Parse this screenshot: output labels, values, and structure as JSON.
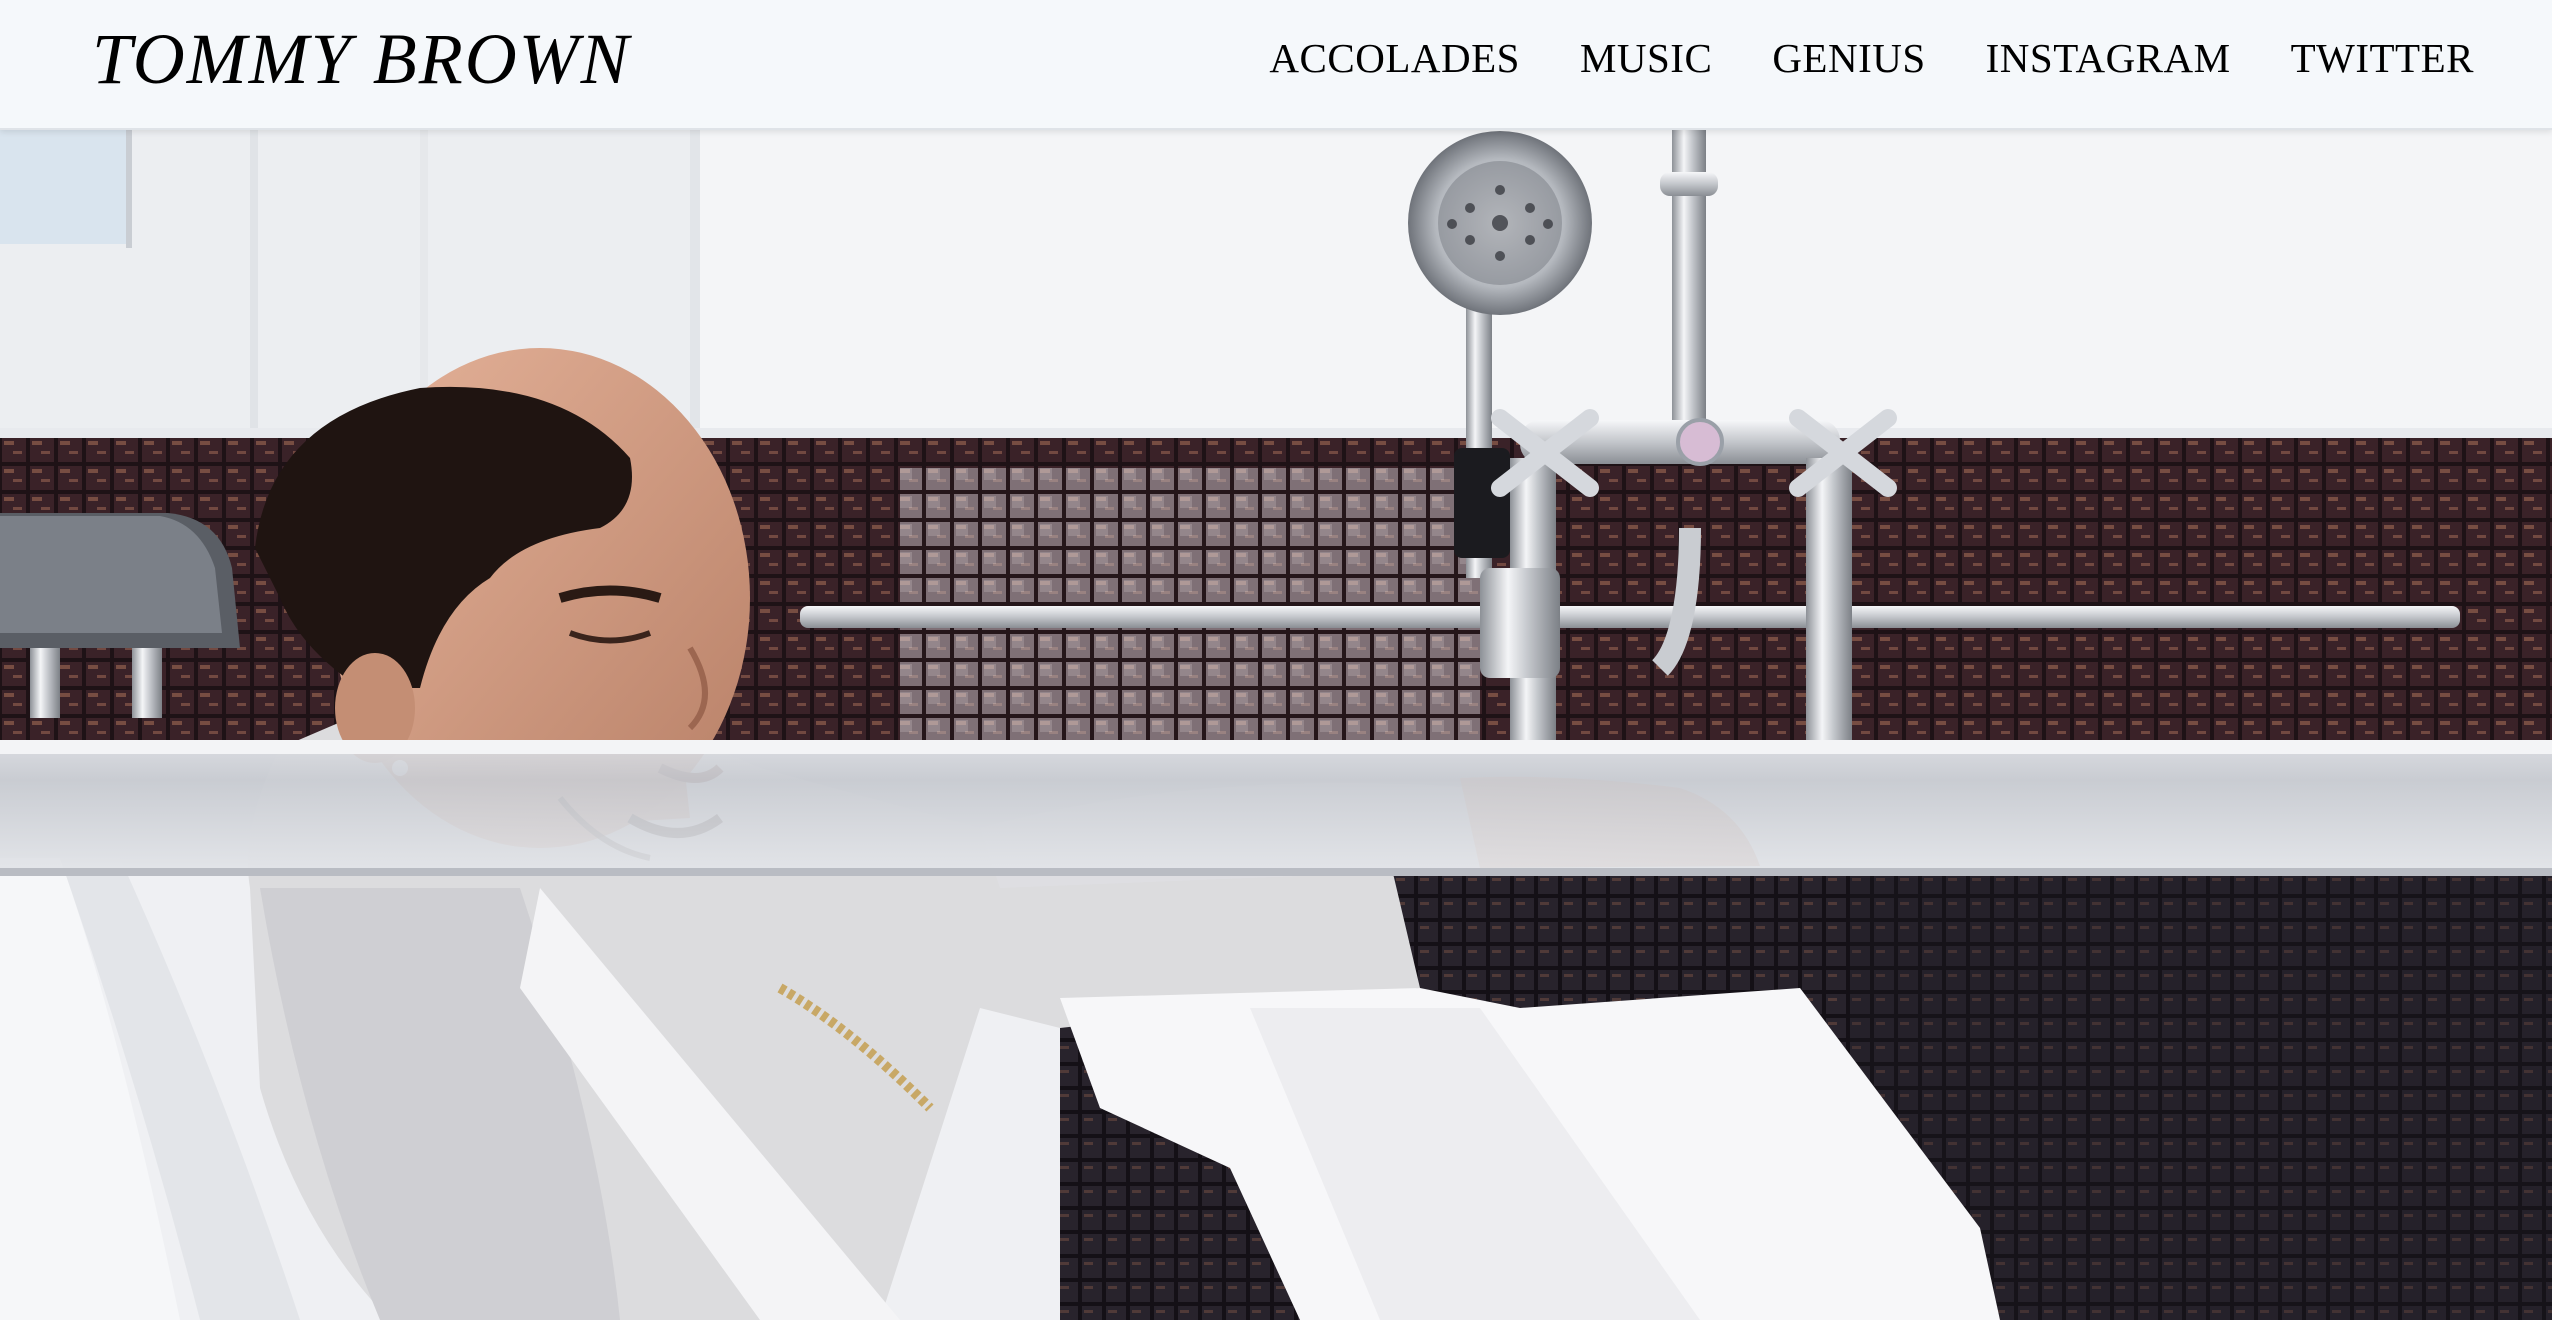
{
  "site": {
    "title": "TOMMY BROWN"
  },
  "nav": {
    "items": [
      {
        "label": "ACCOLADES"
      },
      {
        "label": "MUSIC"
      },
      {
        "label": "GENIUS"
      },
      {
        "label": "INSTAGRAM"
      },
      {
        "label": "TWITTER"
      }
    ]
  },
  "hero": {
    "image": "photo-of-man-reclining-in-white-bathtub",
    "icons": [
      "showerhead",
      "faucet"
    ]
  },
  "colors": {
    "header_bg": "#f5f8fb",
    "text": "#000000",
    "tile_dark": "#2a1a1e",
    "tile_copper": "#8a5a4a",
    "tub_white": "#eeeff2",
    "chrome": "#c9ccd1"
  }
}
